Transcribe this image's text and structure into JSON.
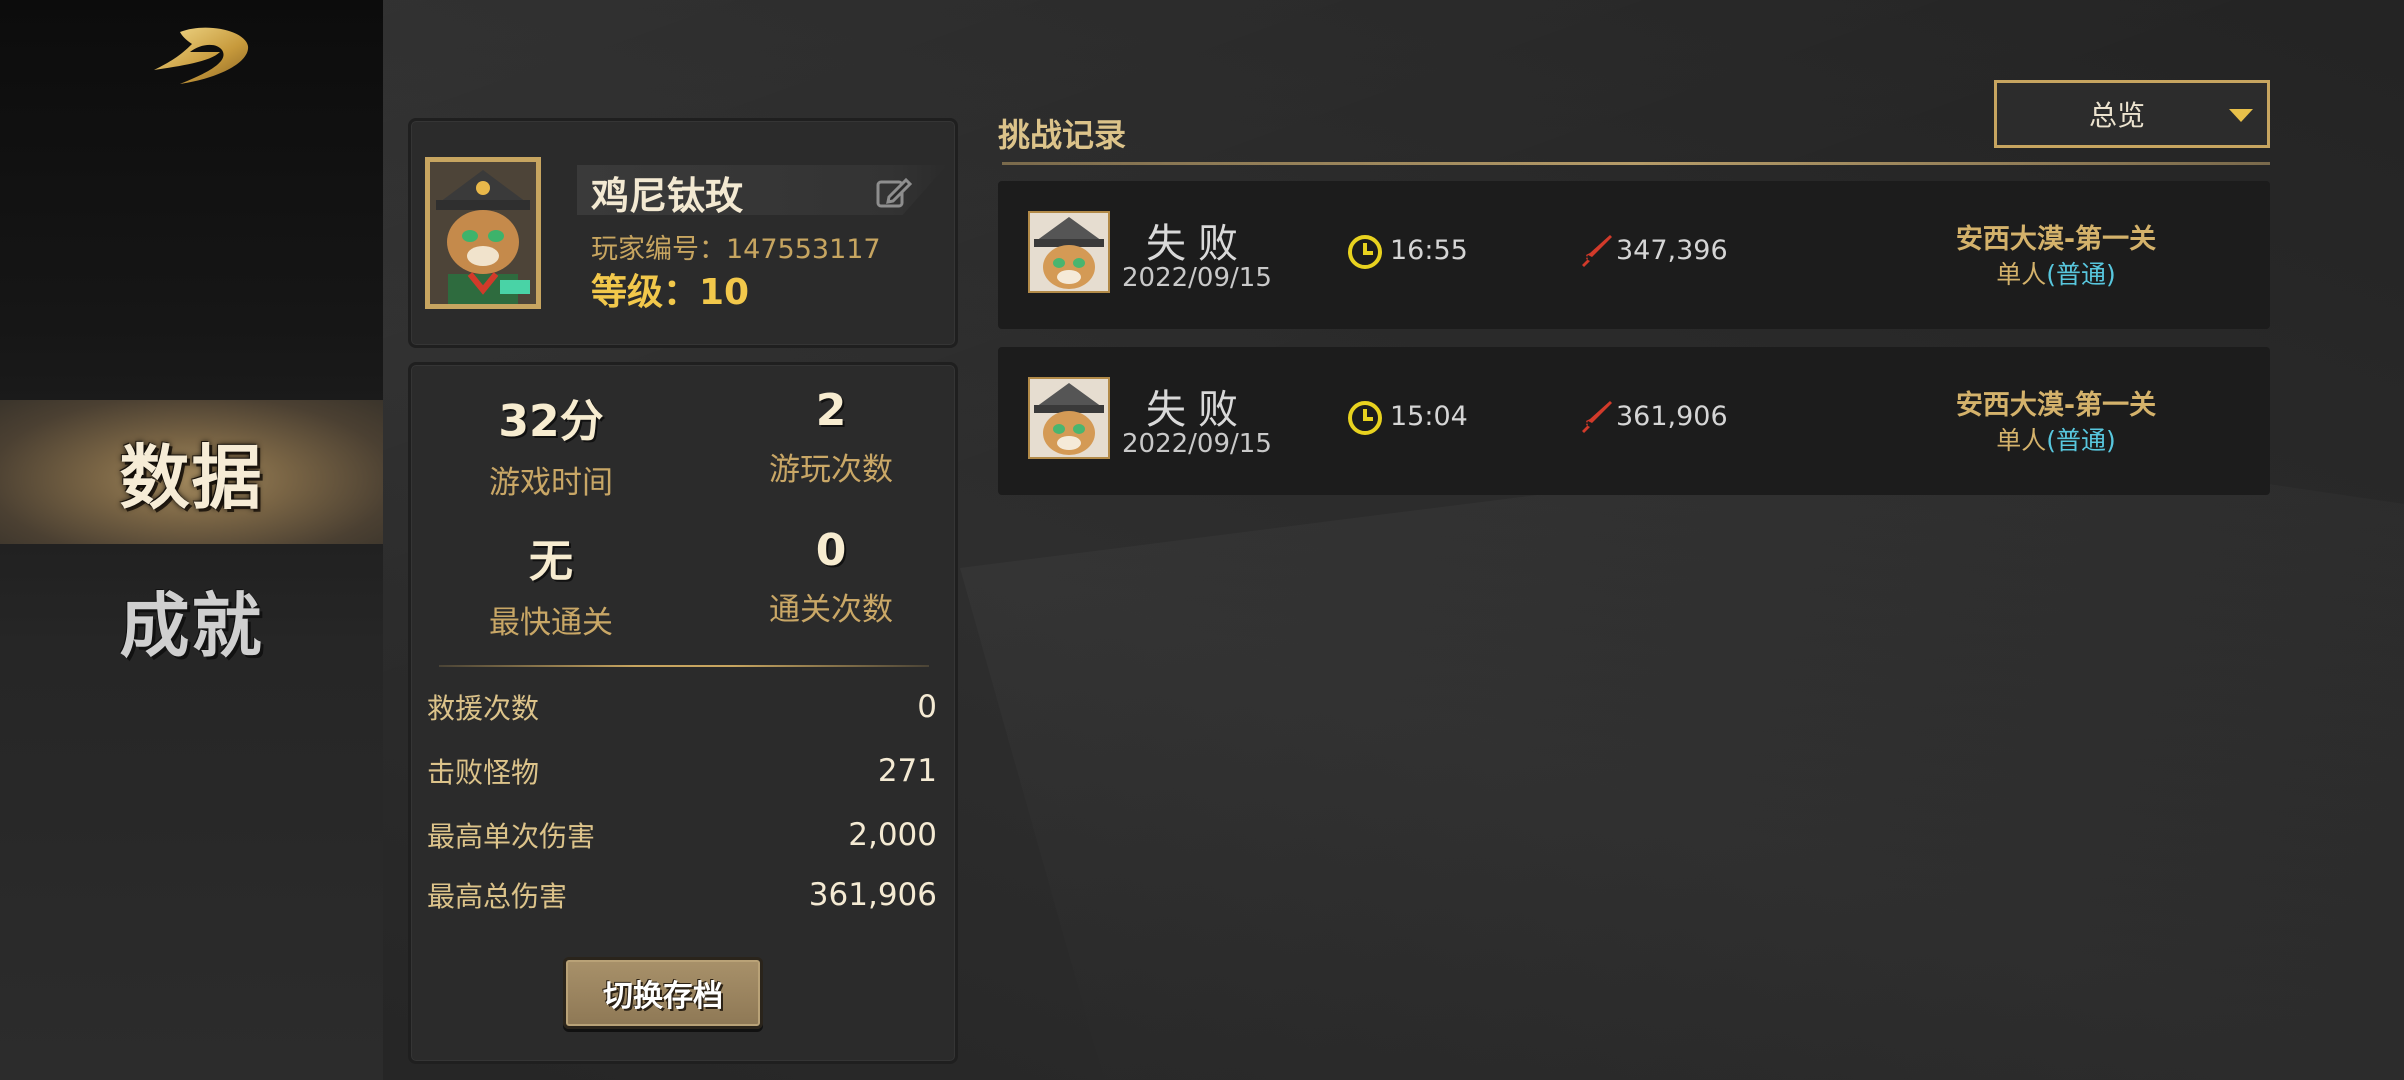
{
  "sidebar": {
    "items": [
      {
        "label": "数据",
        "active": true
      },
      {
        "label": "成就",
        "active": false
      }
    ]
  },
  "profile": {
    "name": "鸡尼钛玫",
    "player_id": "玩家编号：147553117",
    "level": "等级：10"
  },
  "stats": {
    "play_time_value": "32分",
    "play_time_label": "游戏时间",
    "play_count_value": "2",
    "play_count_label": "游玩次数",
    "fastest_clear_value": "无",
    "fastest_clear_label": "最快通关",
    "clear_count_value": "0",
    "clear_count_label": "通关次数",
    "rows": [
      {
        "label": "救援次数",
        "value": "0"
      },
      {
        "label": "击败怪物",
        "value": "271"
      },
      {
        "label": "最高单次伤害",
        "value": "2,000"
      },
      {
        "label": "最高总伤害",
        "value": "361,906"
      }
    ],
    "switch_save_label": "切换存档"
  },
  "records": {
    "title": "挑战记录",
    "filter": {
      "selected": "总览"
    },
    "items": [
      {
        "result": "失败",
        "date": "2022/09/15",
        "time": "16:55",
        "damage": "347,396",
        "stage": "安西大漠-第一关",
        "mode": "单人",
        "difficulty": "(普通)"
      },
      {
        "result": "失败",
        "date": "2022/09/15",
        "time": "15:04",
        "damage": "361,906",
        "stage": "安西大漠-第一关",
        "mode": "单人",
        "difficulty": "(普通)"
      }
    ]
  },
  "colors": {
    "gold": "#c7a560",
    "accent_yellow": "#f2c84b",
    "difficulty_blue": "#58c7de",
    "sword_red": "#d23a2a"
  },
  "icons": {
    "logo": "gold-swoosh-logo",
    "edit": "edit-icon",
    "clock": "clock-icon",
    "damage": "sword-icon",
    "dropdown": "triangle-down-icon"
  }
}
